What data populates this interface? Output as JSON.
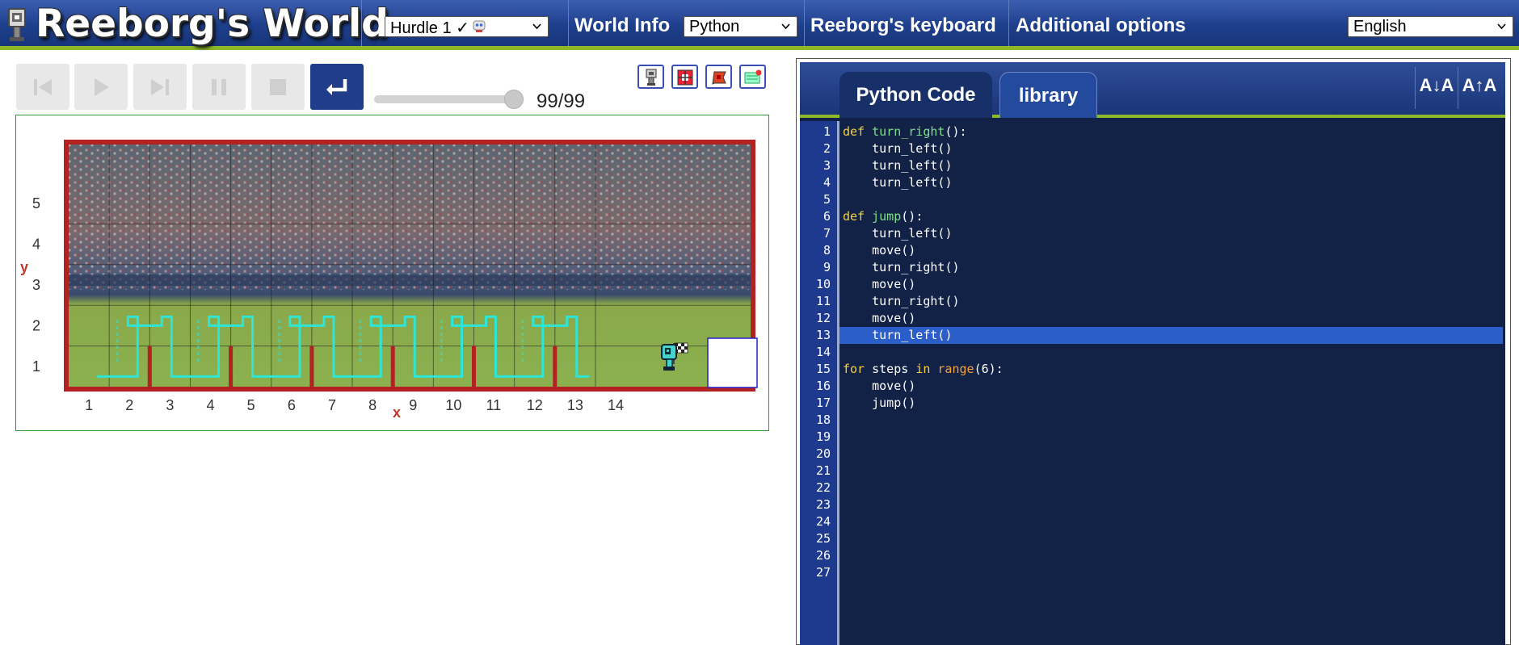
{
  "app": {
    "title": "Reeborg's World"
  },
  "header": {
    "world_select": "Hurdle 1 ✓",
    "world_info": "World Info",
    "language_select": "Python",
    "keyboard": "Reeborg's keyboard",
    "additional_options": "Additional options",
    "ui_language": "English"
  },
  "controls": {
    "buttons": [
      "reload-icon",
      "play-icon",
      "step-icon",
      "pause-icon",
      "stop-icon",
      "enter-icon"
    ],
    "speed": {
      "value": 0.95
    },
    "step_counter": "99/99",
    "tools": [
      "reeborg-robot-icon",
      "highlight-icon",
      "flag-icon",
      "world-edit-icon"
    ]
  },
  "world": {
    "x_label": "x",
    "y_label": "y",
    "x_ticks": [
      "1",
      "2",
      "3",
      "4",
      "5",
      "6",
      "7",
      "8",
      "9",
      "10",
      "11",
      "12",
      "13",
      "14"
    ],
    "y_ticks": [
      "1",
      "2",
      "3",
      "4",
      "5"
    ],
    "wall_color": "#b22222",
    "trace_color": "#2ee6d6",
    "hurdles_at_x": [
      2,
      4,
      6,
      8,
      10,
      12
    ],
    "robot_at": {
      "x": 13,
      "y": 1
    },
    "goal_at": {
      "x": 14,
      "y": 1
    }
  },
  "editor": {
    "tabs": [
      "Python Code",
      "library"
    ],
    "font_down": "A↓A",
    "font_up": "A↑A",
    "current_line": 13,
    "line_count": 27,
    "lines": [
      "def turn_right():",
      "    turn_left()",
      "    turn_left()",
      "    turn_left()",
      "",
      "def jump():",
      "    turn_left()",
      "    move()",
      "    turn_right()",
      "    move()",
      "    turn_right()",
      "    move()",
      "    turn_left()",
      "",
      "for steps in range(6):",
      "    move()",
      "    jump()"
    ]
  }
}
